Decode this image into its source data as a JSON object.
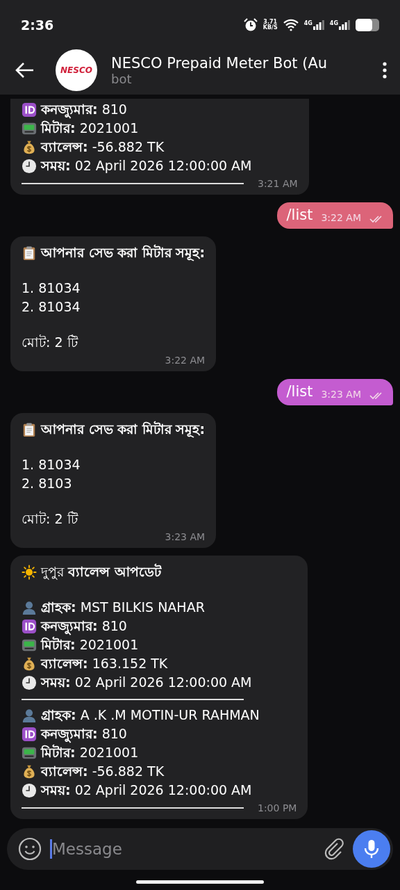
{
  "status_bar": {
    "time": "2:36",
    "net_speed": "3.71",
    "net_unit": "KB/S",
    "signals": [
      "4G",
      "4G"
    ]
  },
  "header": {
    "avatar_text": "NESCO",
    "title": "NESCO Prepaid Meter Bot (Au",
    "subtitle": "bot"
  },
  "messages": [
    {
      "kind": "incoming",
      "clipped_top": true,
      "blocks": [
        {
          "kind": "group",
          "lines": [
            {
              "kind": "id",
              "text": "**কনজ্যুমার:** 810"
            },
            {
              "kind": "meter",
              "text": "**মিটার:** 2021001"
            },
            {
              "kind": "money",
              "text": "**ব্যালেন্স:** -56.882 TK"
            },
            {
              "kind": "clock",
              "text": "**সময়:** 02 April 2026 12:00:00 AM"
            }
          ]
        },
        {
          "kind": "rule"
        }
      ],
      "time": "3:21 AM"
    },
    {
      "kind": "outgoing",
      "text": "/list",
      "time": "3:22 AM",
      "read": true,
      "color": "#dc6479"
    },
    {
      "kind": "incoming",
      "clipped_top": false,
      "blocks": [
        {
          "kind": "group",
          "lines": [
            {
              "kind": "clipboard",
              "text": "**আপনার সেভ করা মিটার সমূহ:**"
            }
          ]
        },
        {
          "kind": "group",
          "lines": [
            {
              "kind": "plain",
              "text": "1. 81034"
            },
            {
              "kind": "plain",
              "text": "2. 81034"
            }
          ]
        },
        {
          "kind": "group",
          "lines": [
            {
              "kind": "plain",
              "text": "মোট: 2 টি"
            }
          ]
        }
      ],
      "time": "3:22 AM"
    },
    {
      "kind": "outgoing",
      "text": "/list",
      "time": "3:23 AM",
      "read": true,
      "color": "#c45cd0"
    },
    {
      "kind": "incoming",
      "clipped_top": false,
      "blocks": [
        {
          "kind": "group",
          "lines": [
            {
              "kind": "clipboard",
              "text": "**আপনার সেভ করা মিটার সমূহ:**"
            }
          ]
        },
        {
          "kind": "group",
          "lines": [
            {
              "kind": "plain",
              "text": "1. 81034"
            },
            {
              "kind": "plain",
              "text": "2. 8103"
            }
          ]
        },
        {
          "kind": "group",
          "lines": [
            {
              "kind": "plain",
              "text": "মোট: 2 টি"
            }
          ]
        }
      ],
      "time": "3:23 AM"
    },
    {
      "kind": "incoming",
      "clipped_top": false,
      "blocks": [
        {
          "kind": "group",
          "lines": [
            {
              "kind": "sun",
              "text": "দুপুর **ব্যালেন্স আপডেট**"
            }
          ]
        },
        {
          "kind": "group",
          "lines": [
            {
              "kind": "person",
              "text": "**গ্রাহক:** MST BILKIS NAHAR"
            },
            {
              "kind": "id",
              "text": "**কনজ্যুমার:** 810"
            },
            {
              "kind": "meter",
              "text": "**মিটার:** 2021001"
            },
            {
              "kind": "money",
              "text": "**ব্যালেন্স:** 163.152 TK"
            },
            {
              "kind": "clock",
              "text": "**সময়:** 02 April 2026 12:00:00 AM"
            }
          ]
        },
        {
          "kind": "rule"
        },
        {
          "kind": "group",
          "lines": [
            {
              "kind": "person",
              "text": "**গ্রাহক:** A .K .M MOTIN-UR RAHMAN"
            },
            {
              "kind": "id",
              "text": "**কনজ্যুমার:** 810"
            },
            {
              "kind": "meter",
              "text": "**মিটার:** 2021001"
            },
            {
              "kind": "money",
              "text": "**ব্যালেন্স:** -56.882 TK"
            },
            {
              "kind": "clock",
              "text": "**সময়:** 02 April 2026 12:00:00 AM"
            }
          ]
        },
        {
          "kind": "rule"
        }
      ],
      "time": "1:00 PM"
    }
  ],
  "composer": {
    "placeholder": "Message"
  }
}
